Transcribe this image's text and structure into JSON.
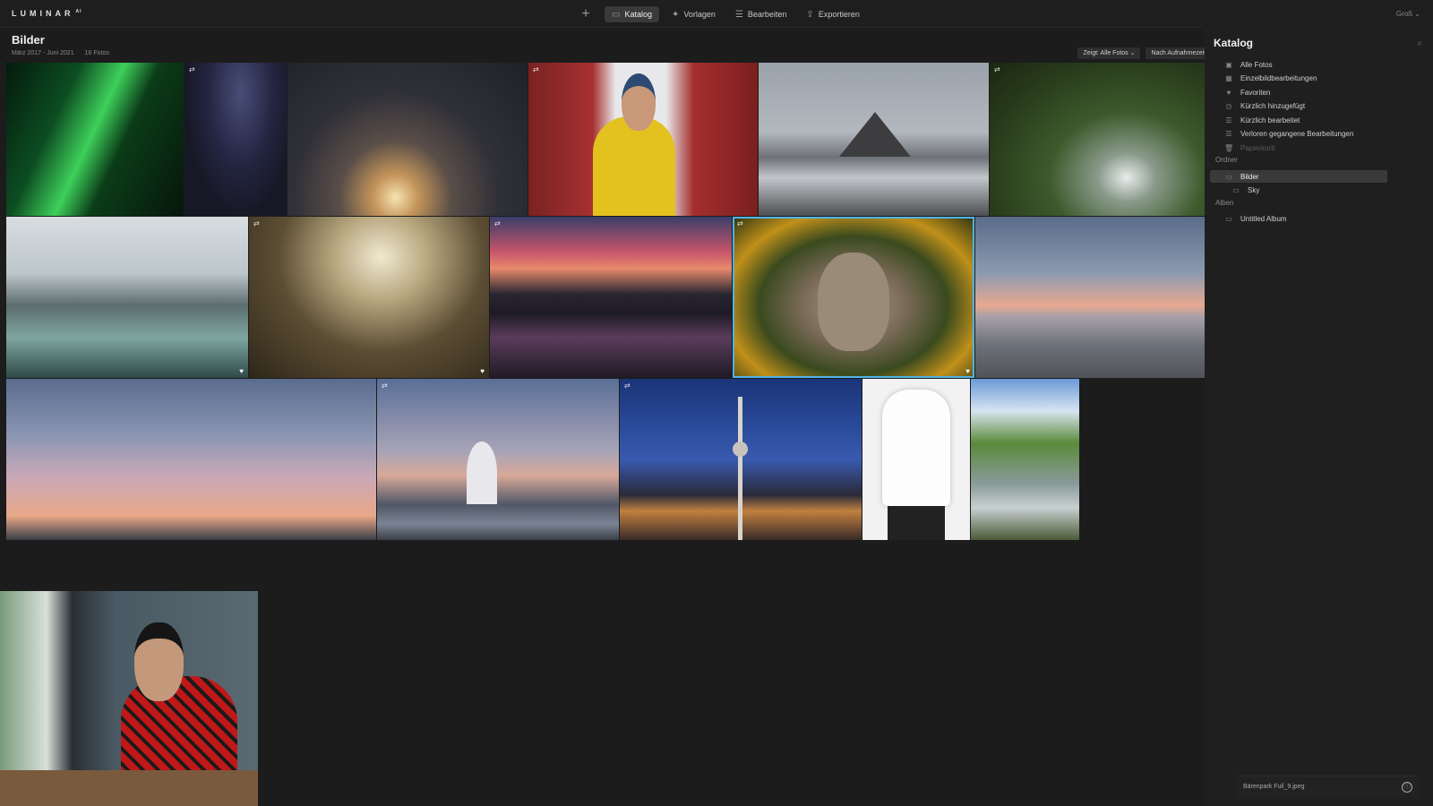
{
  "app": {
    "logo": "LUMINAR",
    "logo_suffix": "AI"
  },
  "topnav": {
    "add_label": "+",
    "tabs": [
      {
        "label": "Katalog",
        "icon": "folder-icon",
        "active": true
      },
      {
        "label": "Vorlagen",
        "icon": "templates-icon",
        "active": false
      },
      {
        "label": "Bearbeiten",
        "icon": "sliders-icon",
        "active": false
      },
      {
        "label": "Exportieren",
        "icon": "export-icon",
        "active": false
      }
    ],
    "size_label": "Groß ⌄"
  },
  "header": {
    "title": "Bilder",
    "date_range": "März 2017 - Juni 2021",
    "count": "16 Fotos",
    "filter_label": "Zeigt: Alle Fotos ⌄",
    "sort_label": "Nach Aufnahmezeit ⌄"
  },
  "photos": [
    {
      "subject": "aurora",
      "edited": false,
      "favorite": false,
      "selected": false
    },
    {
      "subject": "milky-way-boardwalk",
      "edited": true,
      "favorite": false,
      "selected": false
    },
    {
      "subject": "stormy-sunset-clouds",
      "edited": false,
      "favorite": false,
      "selected": false
    },
    {
      "subject": "man-yellow-jacket",
      "edited": true,
      "favorite": false,
      "selected": false
    },
    {
      "subject": "mont-saint-michel",
      "edited": false,
      "favorite": false,
      "selected": false
    },
    {
      "subject": "forest-waterfall",
      "edited": true,
      "favorite": false,
      "selected": false
    },
    {
      "subject": "snowy-lake-trees",
      "edited": false,
      "favorite": true,
      "selected": false
    },
    {
      "subject": "foggy-forest-cabin",
      "edited": true,
      "favorite": true,
      "selected": false
    },
    {
      "subject": "mountain-lake-sunset",
      "edited": true,
      "favorite": false,
      "selected": false
    },
    {
      "subject": "wolf",
      "edited": true,
      "favorite": true,
      "selected": true
    },
    {
      "subject": "sea-sunset-horizon",
      "edited": false,
      "favorite": false,
      "selected": false
    },
    {
      "subject": "pastel-sky",
      "edited": false,
      "favorite": false,
      "selected": false
    },
    {
      "subject": "harbor-hotel-building",
      "edited": true,
      "favorite": false,
      "selected": false
    },
    {
      "subject": "berlin-tv-tower-night",
      "edited": true,
      "favorite": false,
      "selected": false
    },
    {
      "subject": "white-tshirt-model",
      "edited": false,
      "favorite": false,
      "selected": false
    },
    {
      "subject": "river-stream-spring",
      "edited": false,
      "favorite": false,
      "selected": false
    }
  ],
  "sidebar": {
    "title": "Katalog",
    "items": [
      {
        "label": "Alle Fotos",
        "icon": "photos-icon"
      },
      {
        "label": "Einzelbildbearbeitungen",
        "icon": "single-edit-icon"
      },
      {
        "label": "Favoriten",
        "icon": "heart-icon"
      },
      {
        "label": "Kürzlich hinzugefügt",
        "icon": "clock-icon"
      },
      {
        "label": "Kürzlich bearbeitet",
        "icon": "edit-list-icon"
      },
      {
        "label": "Verloren gegangene Bearbeitungen",
        "icon": "lost-edits-icon"
      },
      {
        "label": "Papierkorb",
        "icon": "trash-icon"
      }
    ],
    "folders_label": "Ordner",
    "folders": [
      {
        "label": "Bilder",
        "icon": "folder-icon",
        "selected": true
      },
      {
        "label": "Sky",
        "icon": "folder-icon",
        "selected": false
      }
    ],
    "albums_label": "Alben",
    "albums": [
      {
        "label": "Untitled Album",
        "icon": "album-icon"
      }
    ]
  },
  "infobar": {
    "filename": "Bärenpark Full_9.jpeg",
    "info_icon": "ⓘ"
  }
}
